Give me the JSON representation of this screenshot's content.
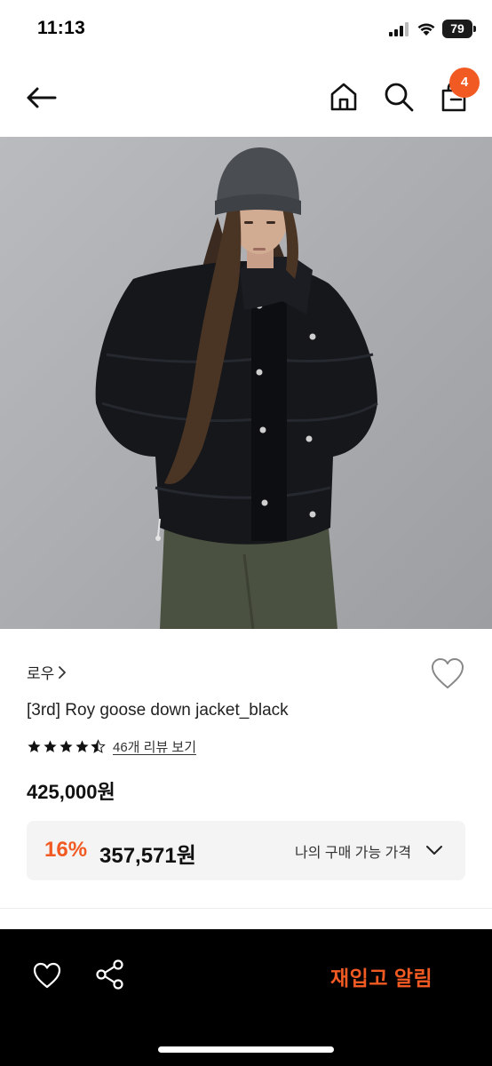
{
  "status_bar": {
    "time": "11:13",
    "battery": "79"
  },
  "nav": {
    "cart_count": "4"
  },
  "product": {
    "brand": "로우",
    "title": "[3rd] Roy goose down jacket_black",
    "rating": 4.5,
    "review_link": "46개 리뷰 보기",
    "price": "425,000원",
    "discount_rate": "16%",
    "discount_price": "357,571원",
    "my_price_label": "나의 구매 가능 가격"
  },
  "bottom_bar": {
    "restock_label": "재입고 알림"
  },
  "colors": {
    "accent": "#f15a22",
    "bottom_bar": "#000000",
    "discount_bg": "#f4f4f4"
  },
  "icons": [
    "back-arrow-icon",
    "home-icon",
    "search-icon",
    "cart-icon",
    "heart-icon",
    "share-icon",
    "chevron-down-icon",
    "star-icon"
  ]
}
